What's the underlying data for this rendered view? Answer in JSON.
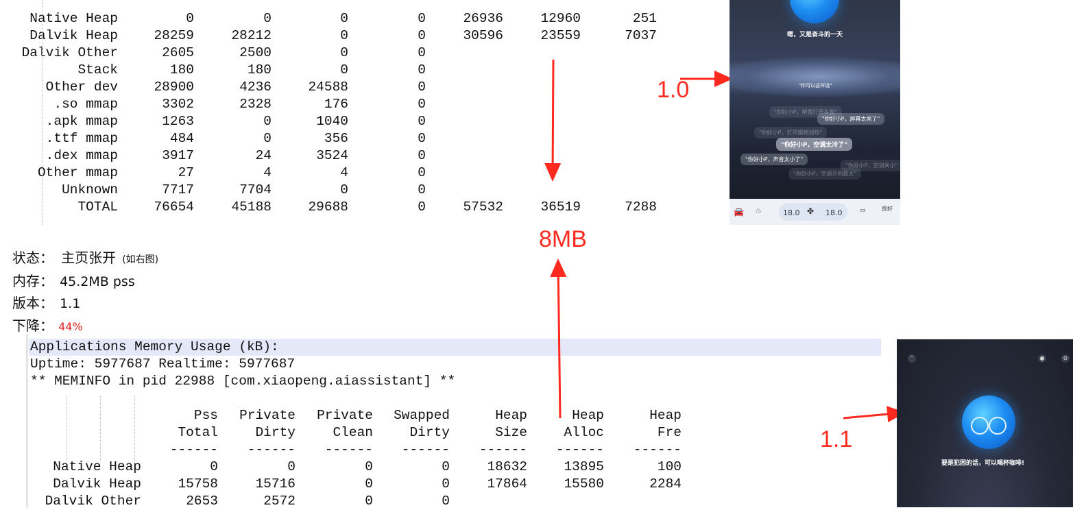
{
  "top_table": {
    "separator": "------",
    "rows": [
      {
        "label": "Native Heap",
        "cells": [
          "0",
          "0",
          "0",
          "0",
          "26936",
          "12960",
          "251"
        ]
      },
      {
        "label": "Dalvik Heap",
        "cells": [
          "28259",
          "28212",
          "0",
          "0",
          "30596",
          "23559",
          "7037"
        ]
      },
      {
        "label": "Dalvik Other",
        "cells": [
          "2605",
          "2500",
          "0",
          "0",
          "",
          "",
          ""
        ]
      },
      {
        "label": "Stack",
        "cells": [
          "180",
          "180",
          "0",
          "0",
          "",
          "",
          ""
        ]
      },
      {
        "label": "Other dev",
        "cells": [
          "28900",
          "4236",
          "24588",
          "0",
          "",
          "",
          ""
        ]
      },
      {
        "label": ".so mmap",
        "cells": [
          "3302",
          "2328",
          "176",
          "0",
          "",
          "",
          ""
        ]
      },
      {
        "label": ".apk mmap",
        "cells": [
          "1263",
          "0",
          "1040",
          "0",
          "",
          "",
          ""
        ]
      },
      {
        "label": ".ttf mmap",
        "cells": [
          "484",
          "0",
          "356",
          "0",
          "",
          "",
          ""
        ]
      },
      {
        "label": ".dex mmap",
        "cells": [
          "3917",
          "24",
          "3524",
          "0",
          "",
          "",
          ""
        ]
      },
      {
        "label": "Other mmap",
        "cells": [
          "27",
          "4",
          "4",
          "0",
          "",
          "",
          ""
        ]
      },
      {
        "label": "Unknown",
        "cells": [
          "7717",
          "7704",
          "0",
          "0",
          "",
          "",
          ""
        ]
      },
      {
        "label": "TOTAL",
        "cells": [
          "76654",
          "45188",
          "29688",
          "0",
          "57532",
          "36519",
          "7288"
        ]
      }
    ]
  },
  "info": {
    "status_key": "状态：",
    "status_value": "主页张开",
    "status_note": "(如右图)",
    "memory_key": "内存：",
    "memory_value": "45.2MB pss",
    "version_key": "版本：",
    "version_value": "1.1",
    "drop_key": "下降：",
    "drop_value": "44%"
  },
  "annotations": {
    "diff": "8MB",
    "version_old": "1.0",
    "version_new": "1.1",
    "arrow_color": "#ff2a1f"
  },
  "bottom_dump": {
    "line1": "Applications Memory Usage (kB):",
    "line2": "Uptime: 5977687 Realtime: 5977687",
    "line3": "** MEMINFO in pid 22988 [com.xiaopeng.aiassistant] **",
    "header_row1": [
      "Pss",
      "Private",
      "Private",
      "Swapped",
      "Heap",
      "Heap",
      "Heap"
    ],
    "header_row2": [
      "Total",
      "Dirty",
      "Clean",
      "Dirty",
      "Size",
      "Alloc",
      "Fre"
    ],
    "separator": "------",
    "rows": [
      {
        "label": "Native Heap",
        "cells": [
          "0",
          "0",
          "0",
          "0",
          "18632",
          "13895",
          "100"
        ]
      },
      {
        "label": "Dalvik Heap",
        "cells": [
          "15758",
          "15716",
          "0",
          "0",
          "17864",
          "15580",
          "2284"
        ]
      },
      {
        "label": "Dalvik Other",
        "cells": [
          "2653",
          "2572",
          "0",
          "0",
          "",
          "",
          ""
        ]
      }
    ]
  },
  "phone_old": {
    "greeting": "嗯，又是奋斗的一天",
    "hint_title": "\"你可以这样说\"",
    "bubbles": [
      "\"你好小P，屏幕太亮了\"",
      "\"你好小P，空调太冷了\"",
      "\"你好小P，声音太小了\"",
      "\"你好小P，帮我打开车窗\"",
      "\"你好小P，空调关小\"",
      "\"你好小P，打开座椅加热\"",
      "\"你好小P，空调开到最大\""
    ],
    "temp_left": "18.0",
    "temp_right": "18.0",
    "status_label": "良好"
  },
  "phone_new": {
    "message": "要是犯困的话，可以喝杯咖啡!"
  }
}
